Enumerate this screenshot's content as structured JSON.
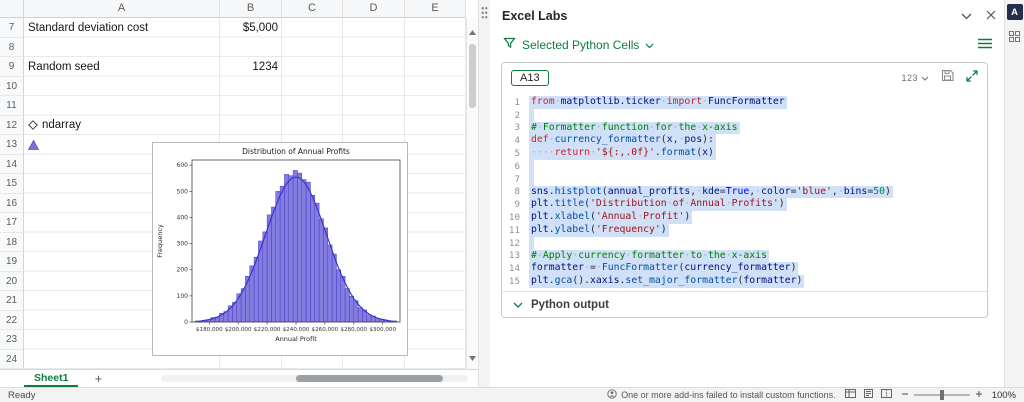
{
  "colors": {
    "brand_green": "#107c41",
    "selection_blue": "#cfe0f7",
    "bar_fill": "#6f66db"
  },
  "spreadsheet": {
    "columns": [
      "A",
      "B",
      "C",
      "D",
      "E"
    ],
    "row_start": 7,
    "row_end": 24,
    "cells": [
      {
        "row": 7,
        "col": "A",
        "text": "Standard deviation cost",
        "align": "left"
      },
      {
        "row": 7,
        "col": "B",
        "text": "$5,000",
        "align": "right"
      },
      {
        "row": 9,
        "col": "A",
        "text": "Random seed",
        "align": "left"
      },
      {
        "row": 9,
        "col": "B",
        "text": "1234",
        "align": "right"
      },
      {
        "row": 12,
        "col": "A",
        "text": "ndarray",
        "align": "left",
        "icon": "ndarray-datatype-icon"
      },
      {
        "row": 13,
        "col": "A",
        "text": "",
        "align": "left",
        "icon": "chart-thumbnail-icon"
      }
    ],
    "sheet_tab": "Sheet1",
    "add_sheet": "+"
  },
  "chart_data": {
    "type": "histogram",
    "title": "Distribution of Annual Profits",
    "xlabel": "Annual Profit",
    "ylabel": "Frequency",
    "x_ticks": [
      "$180,000",
      "$200,000",
      "$220,000",
      "$240,000",
      "$260,000",
      "$280,000",
      "$300,000"
    ],
    "x_tick_values": [
      180000,
      200000,
      220000,
      240000,
      260000,
      280000,
      300000
    ],
    "y_ticks": [
      0,
      100,
      200,
      300,
      400,
      500,
      600
    ],
    "xlim": [
      168000,
      312000
    ],
    "ylim": [
      0,
      620
    ],
    "bin_start": 172000,
    "bin_width": 3000,
    "bars": [
      3,
      7,
      9,
      17,
      19,
      33,
      40,
      62,
      75,
      108,
      128,
      175,
      215,
      248,
      310,
      345,
      410,
      440,
      500,
      520,
      565,
      560,
      580,
      570,
      545,
      535,
      485,
      455,
      395,
      360,
      295,
      260,
      200,
      175,
      128,
      98,
      82,
      55,
      46,
      28,
      23,
      13,
      11,
      7,
      4
    ],
    "kde": {
      "mean": 240000,
      "sigma": 21000,
      "peak": 555
    },
    "bar_color": "#6f66db",
    "bar_edge": "#4a3fc2",
    "kde_color": "#3030cf",
    "legend": "none",
    "grid": false
  },
  "panel": {
    "title": "Excel Labs",
    "filter_label": "Selected Python Cells",
    "cell_ref": "A13",
    "toolbar": {
      "format_label": "123"
    },
    "output_label": "Python output",
    "code_lines": [
      [
        [
          "k",
          "from"
        ],
        [
          "p",
          " "
        ],
        [
          "m",
          "matplotlib.ticker"
        ],
        [
          "p",
          " "
        ],
        [
          "k",
          "import"
        ],
        [
          "p",
          " "
        ],
        [
          "m",
          "FuncFormatter"
        ]
      ],
      [],
      [
        [
          "c",
          "# Formatter function for the x-axis"
        ]
      ],
      [
        [
          "k",
          "def"
        ],
        [
          "p",
          " "
        ],
        [
          "f",
          "currency_formatter"
        ],
        [
          "p",
          "("
        ],
        [
          "m",
          "x"
        ],
        [
          "p",
          ", "
        ],
        [
          "m",
          "pos"
        ],
        [
          "p",
          "):"
        ]
      ],
      [
        [
          "p",
          "    "
        ],
        [
          "k",
          "return"
        ],
        [
          "p",
          " "
        ],
        [
          "s",
          "'${:,.0f}'"
        ],
        [
          "p",
          "."
        ],
        [
          "f",
          "format"
        ],
        [
          "p",
          "("
        ],
        [
          "m",
          "x"
        ],
        [
          "p",
          ")"
        ]
      ],
      [],
      [],
      [
        [
          "m",
          "sns"
        ],
        [
          "p",
          "."
        ],
        [
          "f",
          "histplot"
        ],
        [
          "p",
          "("
        ],
        [
          "m",
          "annual_profits"
        ],
        [
          "p",
          ", "
        ],
        [
          "m",
          "kde"
        ],
        [
          "p",
          "="
        ],
        [
          "b",
          "True"
        ],
        [
          "p",
          ", "
        ],
        [
          "m",
          "color"
        ],
        [
          "p",
          "="
        ],
        [
          "s",
          "'blue'"
        ],
        [
          "p",
          ", "
        ],
        [
          "m",
          "bins"
        ],
        [
          "p",
          "="
        ],
        [
          "n",
          "50"
        ],
        [
          "p",
          ")"
        ]
      ],
      [
        [
          "m",
          "plt"
        ],
        [
          "p",
          "."
        ],
        [
          "f",
          "title"
        ],
        [
          "p",
          "("
        ],
        [
          "s",
          "'Distribution of Annual Profits'"
        ],
        [
          "p",
          ")"
        ]
      ],
      [
        [
          "m",
          "plt"
        ],
        [
          "p",
          "."
        ],
        [
          "f",
          "xlabel"
        ],
        [
          "p",
          "("
        ],
        [
          "s",
          "'Annual Profit'"
        ],
        [
          "p",
          ")"
        ]
      ],
      [
        [
          "m",
          "plt"
        ],
        [
          "p",
          "."
        ],
        [
          "f",
          "ylabel"
        ],
        [
          "p",
          "("
        ],
        [
          "s",
          "'Frequency'"
        ],
        [
          "p",
          ")"
        ]
      ],
      [],
      [
        [
          "c",
          "# Apply currency formatter to the x-axis"
        ]
      ],
      [
        [
          "m",
          "formatter"
        ],
        [
          "p",
          " = "
        ],
        [
          "f",
          "FuncFormatter"
        ],
        [
          "p",
          "("
        ],
        [
          "m",
          "currency_formatter"
        ],
        [
          "p",
          ")"
        ]
      ],
      [
        [
          "m",
          "plt"
        ],
        [
          "p",
          "."
        ],
        [
          "f",
          "gca"
        ],
        [
          "p",
          "()."
        ],
        [
          "m",
          "xaxis"
        ],
        [
          "p",
          "."
        ],
        [
          "f",
          "set_major_formatter"
        ],
        [
          "p",
          "("
        ],
        [
          "m",
          "formatter"
        ],
        [
          "p",
          ")"
        ]
      ]
    ]
  },
  "rail": {
    "addin_initial": "A"
  },
  "status_bar": {
    "ready": "Ready",
    "warning": "One or more add-ins failed to install custom functions.",
    "zoom": "100%"
  }
}
